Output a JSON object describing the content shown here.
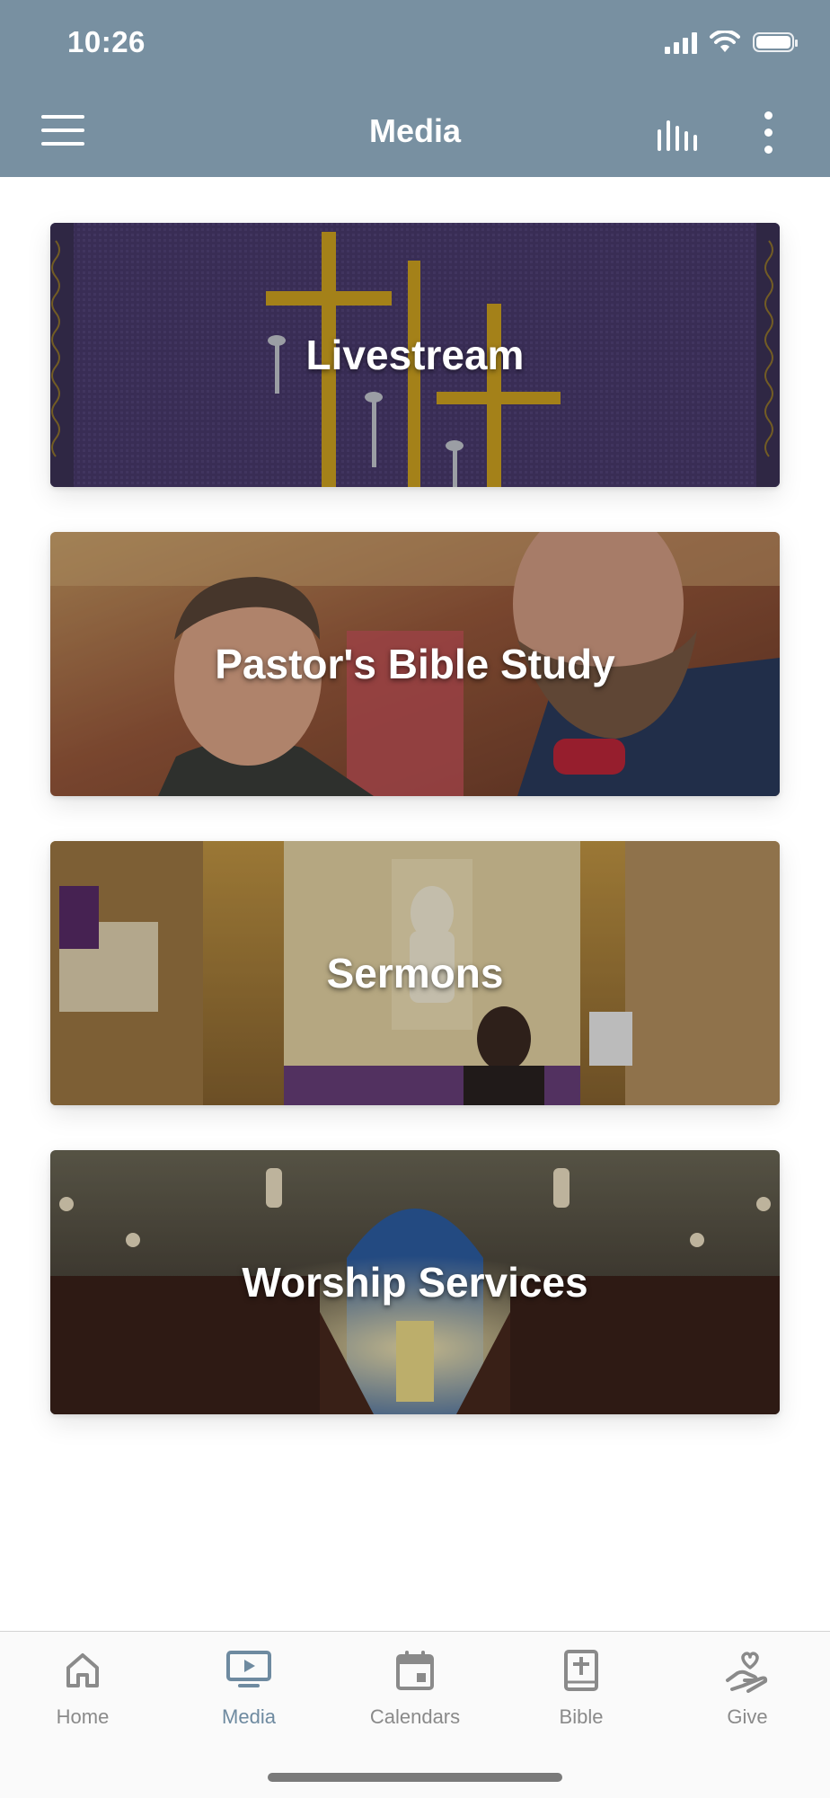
{
  "status_bar": {
    "time": "10:26"
  },
  "header": {
    "title": "Media",
    "menu_icon": "hamburger-menu-icon",
    "audio_icon": "audio-bars-icon",
    "more_icon": "vertical-ellipsis-icon",
    "background_color": "#7890a1"
  },
  "media_cards": [
    {
      "label": "Livestream"
    },
    {
      "label": "Pastor's Bible Study"
    },
    {
      "label": "Sermons"
    },
    {
      "label": "Worship Services"
    }
  ],
  "tab_bar": {
    "active_color": "#6e8aa0",
    "inactive_color": "#8a8a8a",
    "tabs": [
      {
        "label": "Home",
        "icon": "house-icon"
      },
      {
        "label": "Media",
        "icon": "monitor-play-icon",
        "active": true
      },
      {
        "label": "Calendars",
        "icon": "calendar-icon"
      },
      {
        "label": "Bible",
        "icon": "bible-icon"
      },
      {
        "label": "Give",
        "icon": "heart-hand-icon"
      }
    ]
  }
}
